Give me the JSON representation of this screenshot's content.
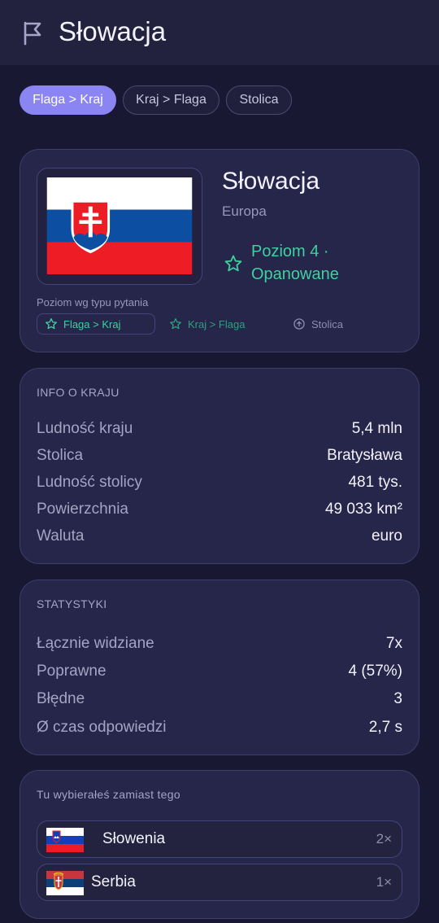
{
  "header": {
    "title": "Słowacja",
    "icon": "flag-icon"
  },
  "modes": [
    {
      "label": "Flaga > Kraj",
      "active": true
    },
    {
      "label": "Kraj > Flaga",
      "active": false
    },
    {
      "label": "Stolica",
      "active": false
    }
  ],
  "country": {
    "name": "Słowacja",
    "continent": "Europa",
    "level_text": "Poziom 4 · Opanowane",
    "level_type_label": "Poziom wg typu pytania",
    "level_types": [
      "Flaga > Kraj",
      "Kraj > Flaga",
      "Stolica"
    ],
    "flag_colors": {
      "white": "#ffffff",
      "blue": "#0b4ea2",
      "red": "#ee1c25"
    }
  },
  "info": {
    "title": "INFO O KRAJU",
    "rows": [
      {
        "label": "Ludność kraju",
        "value": "5,4 mln"
      },
      {
        "label": "Stolica",
        "value": "Bratysława"
      },
      {
        "label": "Ludność stolicy",
        "value": "481 tys."
      },
      {
        "label": "Powierzchnia",
        "value": "49 033 km²"
      },
      {
        "label": "Waluta",
        "value": "euro"
      }
    ]
  },
  "stats": {
    "title": "STATYSTYKI",
    "rows": [
      {
        "label": "Łącznie widziane",
        "value": "7x"
      },
      {
        "label": "Poprawne",
        "value": "4 (57%)"
      },
      {
        "label": "Błędne",
        "value": "3"
      },
      {
        "label": "Ø czas odpowiedzi",
        "value": "2,7 s"
      }
    ]
  },
  "confusions": {
    "title": "Tu wybierałeś zamiast tego",
    "items": [
      {
        "name": "Słowenia",
        "count": "2×"
      },
      {
        "name": "Serbia",
        "count": "1×"
      }
    ]
  },
  "colors": {
    "background": "#191833",
    "accent": "#8b84f3",
    "mastered": "#3fd0a0",
    "card": "#26254a"
  }
}
